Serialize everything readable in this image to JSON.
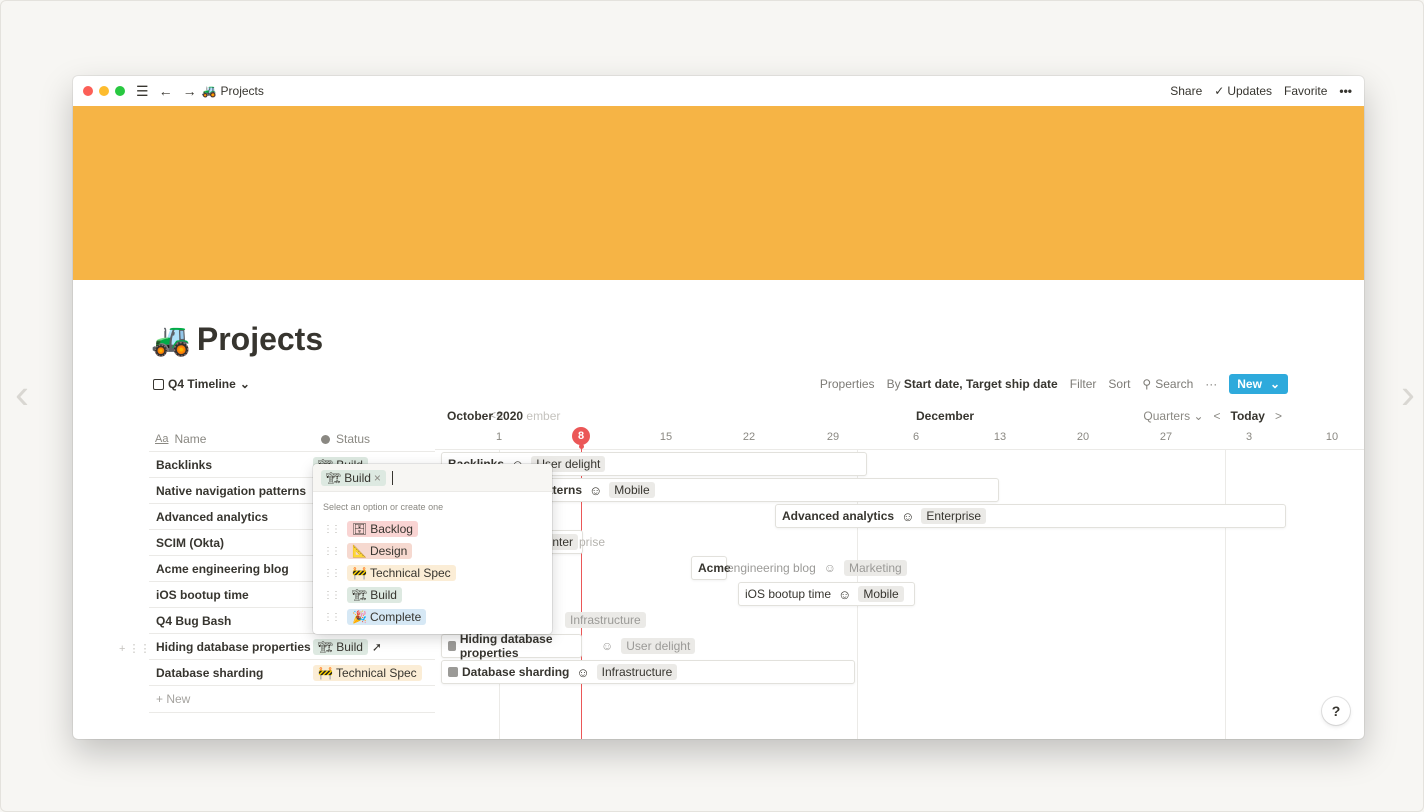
{
  "window": {
    "title": "Projects",
    "title_emoji": "🚜",
    "menu_icon": "☰",
    "back_icon": "←",
    "forward_icon": "→",
    "share": "Share",
    "updates": "Updates",
    "updates_check": "✓",
    "favorite": "Favorite",
    "more": "•••"
  },
  "colors": {
    "cover": "#f6b445",
    "accent": "#2eaadc",
    "today": "#eb5757"
  },
  "page": {
    "title": "Projects",
    "emoji": "🚜"
  },
  "view": {
    "name": "Q4 Timeline",
    "chevron": "⌄",
    "properties": "Properties",
    "by_label": "By",
    "by_value": "Start date, Target ship date",
    "filter": "Filter",
    "sort": "Sort",
    "search": "Search",
    "more": "···",
    "new": "New",
    "new_chevron": "⌄"
  },
  "table": {
    "collapse": "<<",
    "col_name": "Name",
    "col_name_icon": "Aa",
    "col_status": "Status",
    "rows": [
      {
        "name": "Backlinks",
        "status": "Build"
      },
      {
        "name": "Native navigation patterns",
        "status": ""
      },
      {
        "name": "Advanced analytics",
        "status": ""
      },
      {
        "name": "SCIM (Okta)",
        "status": ""
      },
      {
        "name": "Acme engineering blog",
        "status": ""
      },
      {
        "name": "iOS bootup time",
        "status": ""
      },
      {
        "name": "Q4 Bug Bash",
        "status": ""
      },
      {
        "name": "Hiding database properties",
        "status": "Build"
      },
      {
        "name": "Database sharding",
        "status": "Technical Spec"
      }
    ],
    "new_row": "+ New"
  },
  "timeline": {
    "month_1": "October 2020",
    "month_1_fade": "ember",
    "month_2": "December",
    "days": [
      "1",
      "8",
      "15",
      "22",
      "29",
      "6",
      "13",
      "20",
      "27",
      "3",
      "10"
    ],
    "zoom": "Quarters",
    "zoom_chevron": "⌄",
    "prev": "<",
    "today": "Today",
    "next": ">",
    "bars": {
      "backlinks": {
        "name": "Backlinks",
        "tag": "User delight"
      },
      "native": {
        "name": "atterns",
        "tag": "Mobile"
      },
      "analytics": {
        "name": "Advanced analytics",
        "tag": "Enterprise"
      },
      "scim": {
        "tag_visible": "Enter",
        "tag_faded": "prise"
      },
      "blog": {
        "name_bold": "Acme",
        "name_faded": "engineering blog",
        "tag": "Marketing"
      },
      "ios": {
        "name": "iOS bootup time",
        "tag": "Mobile"
      },
      "bugbash": {
        "tag": "Infrastructure"
      },
      "hiding": {
        "name": "Hiding database properties",
        "tag": "User delight"
      },
      "sharding": {
        "name": "Database sharding",
        "tag": "Infrastructure"
      }
    }
  },
  "status_popup": {
    "selected": "Build",
    "remove": "×",
    "hint": "Select an option or create one",
    "options": [
      {
        "label": "Backlog",
        "icon": "🗄",
        "color": "#f9d4d3"
      },
      {
        "label": "Design",
        "icon": "📐",
        "color": "#f6d9d0"
      },
      {
        "label": "Technical Spec",
        "icon": "🚧",
        "color": "#fbedd6"
      },
      {
        "label": "Build",
        "icon": "🏗",
        "color": "#dde9e1"
      },
      {
        "label": "Complete",
        "icon": "🎉",
        "color": "#d6e8f5"
      }
    ]
  },
  "help": "?"
}
